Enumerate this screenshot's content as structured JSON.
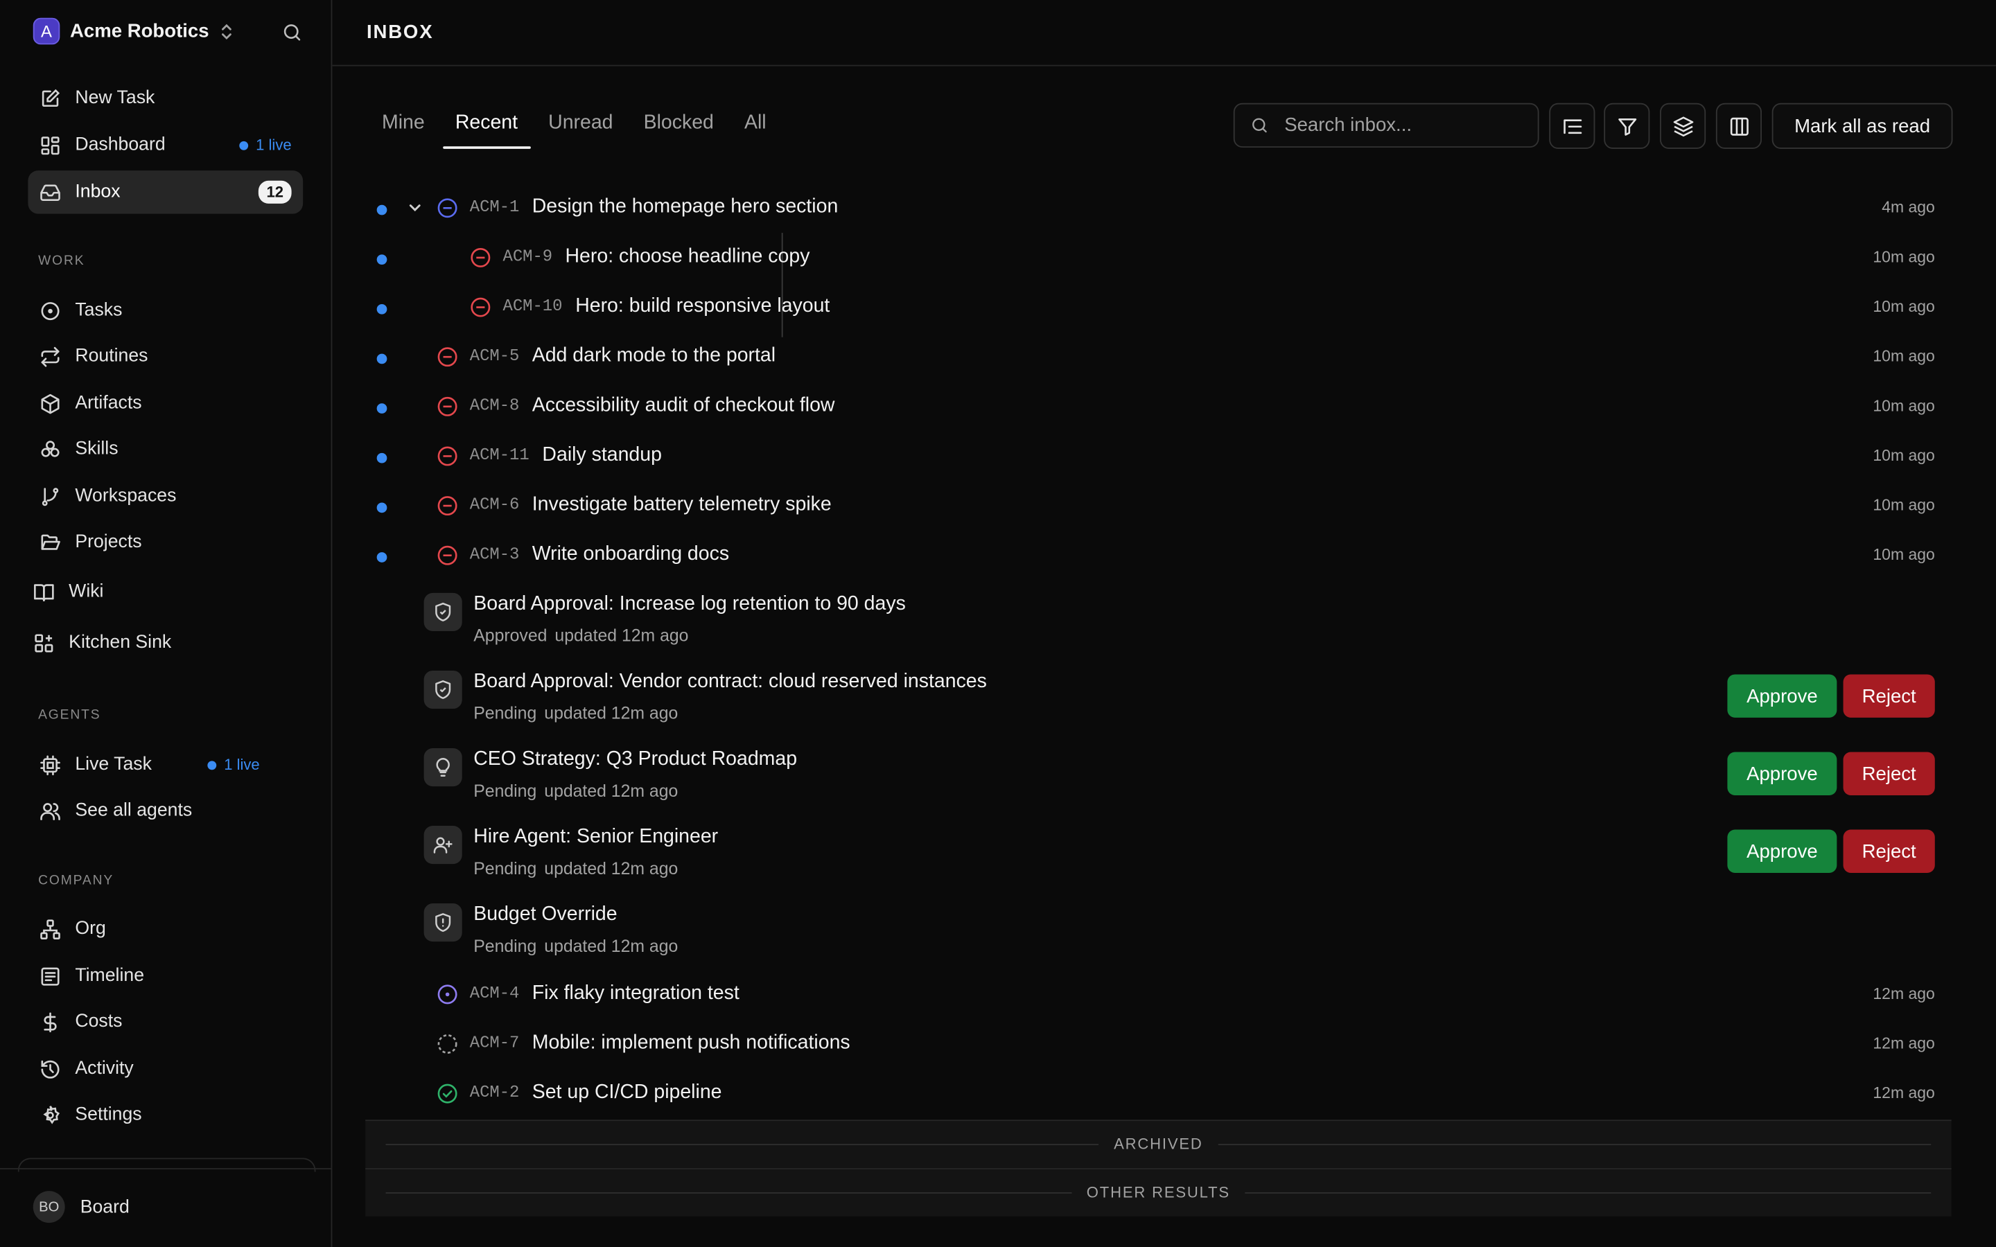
{
  "workspace": {
    "initial": "A",
    "name": "Acme Robotics"
  },
  "sidebar": {
    "top": [
      {
        "label": "New Task"
      },
      {
        "label": "Dashboard",
        "live": "1 live"
      },
      {
        "label": "Inbox",
        "count": "12"
      }
    ],
    "work_title": "WORK",
    "work": [
      {
        "label": "Tasks"
      },
      {
        "label": "Routines"
      },
      {
        "label": "Artifacts"
      },
      {
        "label": "Skills"
      },
      {
        "label": "Workspaces"
      },
      {
        "label": "Projects"
      },
      {
        "label": "Wiki"
      },
      {
        "label": "Kitchen Sink"
      }
    ],
    "agents_title": "AGENTS",
    "agents": [
      {
        "label": "Live Task",
        "live": "1 live"
      },
      {
        "label": "See all agents"
      }
    ],
    "company_title": "COMPANY",
    "company": [
      {
        "label": "Org"
      },
      {
        "label": "Timeline"
      },
      {
        "label": "Costs"
      },
      {
        "label": "Activity"
      },
      {
        "label": "Settings"
      }
    ],
    "user": {
      "initials": "BO",
      "name": "Board"
    }
  },
  "header": {
    "title": "INBOX"
  },
  "tabs": [
    {
      "label": "Mine"
    },
    {
      "label": "Recent"
    },
    {
      "label": "Unread"
    },
    {
      "label": "Blocked"
    },
    {
      "label": "All"
    }
  ],
  "active_tab": "Recent",
  "search": {
    "placeholder": "Search inbox..."
  },
  "toolbar": {
    "mark_all_read": "Mark all as read"
  },
  "tasks": [
    {
      "id": "ACM-1",
      "title": "Design the homepage hero section",
      "time": "4m ago",
      "status": "in-progress",
      "unread": true,
      "expanded": true
    },
    {
      "id": "ACM-9",
      "title": "Hero: choose headline copy",
      "time": "10m ago",
      "status": "blocked",
      "unread": true,
      "child": true
    },
    {
      "id": "ACM-10",
      "title": "Hero: build responsive layout",
      "time": "10m ago",
      "status": "blocked",
      "unread": true,
      "child": true
    },
    {
      "id": "ACM-5",
      "title": "Add dark mode to the portal",
      "time": "10m ago",
      "status": "blocked",
      "unread": true
    },
    {
      "id": "ACM-8",
      "title": "Accessibility audit of checkout flow",
      "time": "10m ago",
      "status": "blocked",
      "unread": true
    },
    {
      "id": "ACM-11",
      "title": "Daily standup",
      "time": "10m ago",
      "status": "blocked",
      "unread": true
    },
    {
      "id": "ACM-6",
      "title": "Investigate battery telemetry spike",
      "time": "10m ago",
      "status": "blocked",
      "unread": true
    },
    {
      "id": "ACM-3",
      "title": "Write onboarding docs",
      "time": "10m ago",
      "status": "blocked",
      "unread": true
    }
  ],
  "approvals": [
    {
      "title": "Board Approval: Increase log retention to 90 days",
      "status": "Approved",
      "updated": "updated 12m ago",
      "icon": "shield-check-icon"
    },
    {
      "title": "Board Approval: Vendor contract: cloud reserved instances",
      "status": "Pending",
      "updated": "updated 12m ago",
      "icon": "shield-check-icon",
      "approve": "Approve",
      "reject": "Reject"
    },
    {
      "title": "CEO Strategy: Q3 Product Roadmap",
      "status": "Pending",
      "updated": "updated 12m ago",
      "icon": "lightbulb-icon",
      "approve": "Approve",
      "reject": "Reject"
    },
    {
      "title": "Hire Agent: Senior Engineer",
      "status": "Pending",
      "updated": "updated 12m ago",
      "icon": "user-plus-icon",
      "approve": "Approve",
      "reject": "Reject"
    },
    {
      "title": "Budget Override",
      "status": "Pending",
      "updated": "updated 12m ago",
      "icon": "shield-alert-icon"
    }
  ],
  "more_tasks": [
    {
      "id": "ACM-4",
      "title": "Fix flaky integration test",
      "time": "12m ago",
      "status": "in-review"
    },
    {
      "id": "ACM-7",
      "title": "Mobile: implement push notifications",
      "time": "12m ago",
      "status": "backlog"
    },
    {
      "id": "ACM-2",
      "title": "Set up CI/CD pipeline",
      "time": "12m ago",
      "status": "done"
    }
  ],
  "sections": {
    "archived": "ARCHIVED",
    "other": "OTHER RESULTS"
  },
  "colors": {
    "unread": "#3b8cf3",
    "approve": "#15843b",
    "reject": "#a61b22",
    "blocked": "#e5484d",
    "in_progress": "#5b6cf0",
    "in_review": "#8e7cf0",
    "done": "#2fb36a"
  }
}
